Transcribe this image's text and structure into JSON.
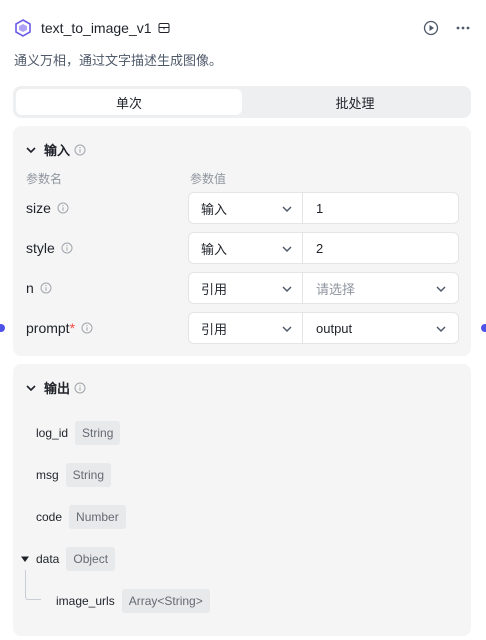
{
  "node": {
    "title": "text_to_image_v1",
    "description": "通义万相，通过文字描述生成图像。"
  },
  "tabs": [
    {
      "label": "单次",
      "active": true
    },
    {
      "label": "批处理",
      "active": false
    }
  ],
  "input_section": {
    "title": "输入",
    "col_name": "参数名",
    "col_value": "参数值",
    "params": [
      {
        "name": "size",
        "required": false,
        "source": "输入",
        "value": "1",
        "value_is_placeholder": false
      },
      {
        "name": "style",
        "required": false,
        "source": "输入",
        "value": "2",
        "value_is_placeholder": false
      },
      {
        "name": "n",
        "required": false,
        "source": "引用",
        "value": "请选择",
        "value_is_placeholder": true
      },
      {
        "name": "prompt",
        "required": true,
        "source": "引用",
        "value": "output",
        "value_is_placeholder": false
      }
    ],
    "required_mark": "*"
  },
  "output_section": {
    "title": "输出",
    "fields": [
      {
        "name": "log_id",
        "type": "String"
      },
      {
        "name": "msg",
        "type": "String"
      },
      {
        "name": "code",
        "type": "Number"
      },
      {
        "name": "data",
        "type": "Object"
      },
      {
        "name": "image_urls",
        "type": "Array<String>"
      }
    ]
  },
  "colors": {
    "accent": "#4d53e8",
    "required": "#f54a45",
    "panel_bg": "#f5f5f6"
  },
  "icons": {
    "logo": "tongyi-logo-icon",
    "tool": "tool-card-icon",
    "run": "play-circle-icon",
    "more": "more-horizontal-icon",
    "collapse": "chevron-down-icon",
    "info": "info-circle-icon",
    "expand": "caret-down-icon"
  }
}
